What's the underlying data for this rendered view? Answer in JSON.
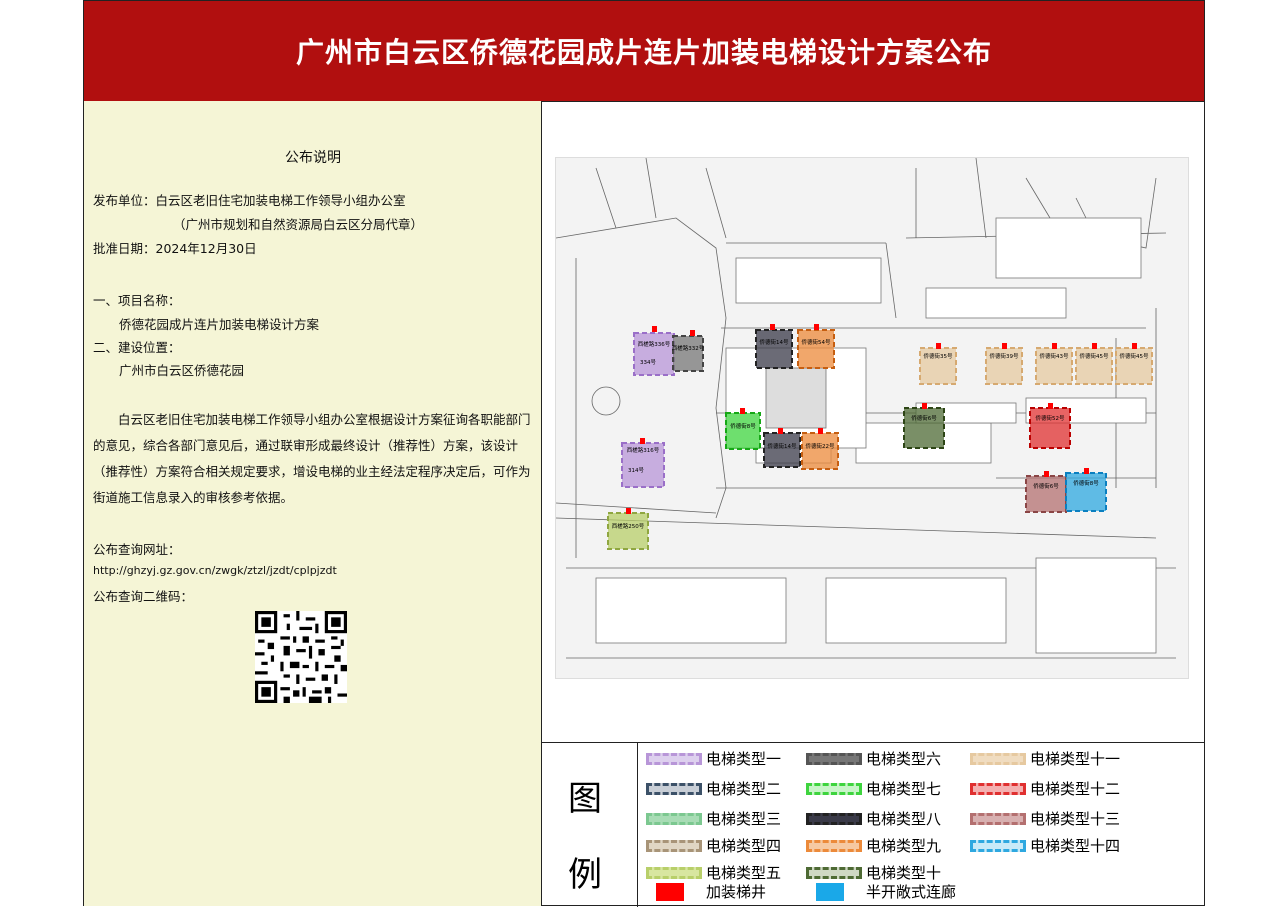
{
  "header": {
    "title": "广州市白云区侨德花园成片连片加装电梯设计方案公布"
  },
  "notice": {
    "title": "公布说明",
    "publisher": "发布单位：白云区老旧住宅加装电梯工作领导小组办公室",
    "publisher_sub": "（广州市规划和自然资源局白云区分局代章）",
    "approval_date": "批准日期：2024年12月30日",
    "item1_label": "一、项目名称：",
    "item1_value": "侨德花园成片连片加装电梯设计方案",
    "item2_label": "二、建设位置：",
    "item2_value": "广州市白云区侨德花园",
    "paragraph": "白云区老旧住宅加装电梯工作领导小组办公室根据设计方案征询各职能部门的意见，综合各部门意见后，通过联审形成最终设计（推荐性）方案，该设计（推荐性）方案符合相关规定要求，增设电梯的业主经法定程序决定后，可作为街道施工信息录入的审核参考依据。",
    "query_url_label": "公布查询网址：",
    "query_url": "http://ghzyj.gz.gov.cn/zwgk/ztzl/jzdt/cplpjzdt",
    "qr_label": "公布查询二维码："
  },
  "map": {
    "buildings": [
      {
        "label": "西槎路336号",
        "color": "#b896d8"
      },
      {
        "label": "334号",
        "color": "#b896d8"
      },
      {
        "label": "西槎路332号",
        "color": "#666666"
      },
      {
        "label": "侨德街14号",
        "color": "#3a3a48"
      },
      {
        "label": "侨德街54号",
        "color": "#ec8a3a"
      },
      {
        "label": "侨德街8号",
        "color": "#3ed43e"
      },
      {
        "label": "侨德街14号",
        "color": "#3a3a48"
      },
      {
        "label": "侨德街22号",
        "color": "#ec8a3a"
      },
      {
        "label": "西槎路316号",
        "color": "#b896d8"
      },
      {
        "label": "314号",
        "color": "#b896d8"
      },
      {
        "label": "西槎路250号",
        "color": "#b8cf6a"
      },
      {
        "label": "侨德街35号",
        "color": "#e6c9a0"
      },
      {
        "label": "侨德街39号",
        "color": "#e6c9a0"
      },
      {
        "label": "侨德街43号",
        "color": "#e6c9a0"
      },
      {
        "label": "侨德街45号",
        "color": "#e6c9a0"
      },
      {
        "label": "侨德街45号",
        "color": "#e6c9a0"
      },
      {
        "label": "侨德街6号",
        "color": "#4e6a34"
      },
      {
        "label": "侨德街52号",
        "color": "#e03030"
      },
      {
        "label": "侨德街6号",
        "color": "#b47070"
      },
      {
        "label": "侨德街8号",
        "color": "#2ea8e0"
      }
    ]
  },
  "legend": {
    "head_top": "图",
    "head_bottom": "例",
    "items": [
      {
        "label": "电梯类型一",
        "color": "#b896d8"
      },
      {
        "label": "电梯类型二",
        "color": "#3c5168"
      },
      {
        "label": "电梯类型三",
        "color": "#7cc890"
      },
      {
        "label": "电梯类型四",
        "color": "#a89478"
      },
      {
        "label": "电梯类型五",
        "color": "#b8cf6a"
      },
      {
        "label": "电梯类型六",
        "color": "#666666"
      },
      {
        "label": "电梯类型七",
        "color": "#3ed43e"
      },
      {
        "label": "电梯类型八",
        "color": "#3a3a48"
      },
      {
        "label": "电梯类型九",
        "color": "#ec8a3a"
      },
      {
        "label": "电梯类型十",
        "color": "#4e6a34"
      },
      {
        "label": "电梯类型十一",
        "color": "#e6c9a0"
      },
      {
        "label": "电梯类型十二",
        "color": "#e03030"
      },
      {
        "label": "电梯类型十三",
        "color": "#b47070"
      },
      {
        "label": "电梯类型十四",
        "color": "#2ea8e0"
      }
    ],
    "shaft": {
      "label": "加装梯井",
      "color": "#ff0000"
    },
    "corridor": {
      "label": "半开敞式连廊",
      "color": "#1aa8e8"
    }
  }
}
